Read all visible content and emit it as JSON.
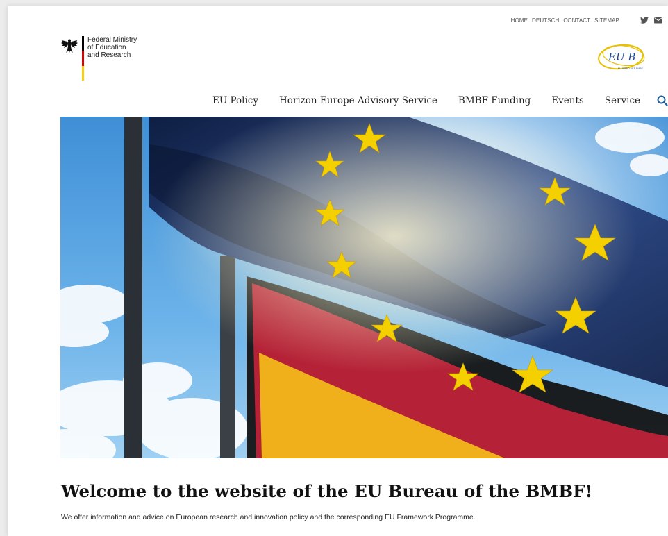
{
  "utility_nav": {
    "links": [
      "HOME",
      "DEUTSCH",
      "CONTACT",
      "SITEMAP"
    ],
    "icons": [
      "twitter-icon",
      "mail-icon"
    ]
  },
  "logo": {
    "ministry_lines": [
      "Federal Ministry",
      "of Education",
      "and Research"
    ],
    "eub_text": "EU B",
    "eub_subtext": "EU-BÜRO DES BMBF"
  },
  "main_nav": {
    "items": [
      "EU Policy",
      "Horizon Europe Advisory Service",
      "BMBF Funding",
      "Events",
      "Service"
    ],
    "search_icon": "search-icon"
  },
  "intro": {
    "headline": "Welcome to the website of the EU Bureau of the BMBF!",
    "text": "We offer information and advice on European research and innovation policy and the corresponding EU Framework Programme."
  },
  "colors": {
    "nav_accent": "#1f5a9a",
    "flag_black": "#000000",
    "flag_red": "#dd0000",
    "flag_gold": "#ffce00",
    "eu_blue": "#1a2a66",
    "eu_star": "#f5d000"
  }
}
